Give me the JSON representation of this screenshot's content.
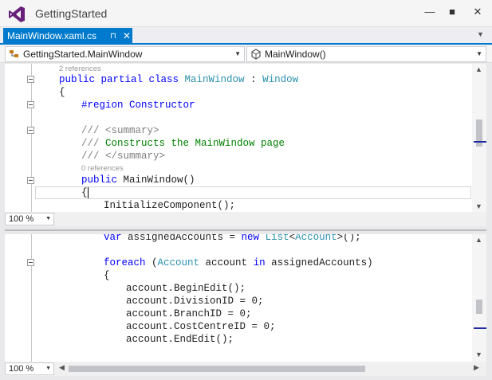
{
  "window": {
    "title": "GettingStarted",
    "minimize_icon": "minimize-icon",
    "maximize_icon": "maximize-icon",
    "close_icon": "close-icon"
  },
  "tab": {
    "label": "MainWindow.xaml.cs",
    "pin_icon": "pin-icon",
    "close_icon": "close-icon"
  },
  "navbar": {
    "class_combo": "GettingStarted.MainWindow",
    "member_combo": "MainWindow()"
  },
  "pane1": {
    "zoom": "100 %",
    "codelens_class": "2 references",
    "codelens_ctor": "0 references",
    "line1_kw": "public partial class ",
    "line1_type": "MainWindow",
    "line1_sep": " : ",
    "line1_base": "Window",
    "line2": "{",
    "line3_region": "#region Constructor",
    "line4_prefix": "/// ",
    "line4_tag": "<summary>",
    "line5_prefix": "/// ",
    "line5_text": "Constructs the MainWindow page",
    "line6_prefix": "/// ",
    "line6_tag": "</summary>",
    "line7_kw": "public ",
    "line7_rest": "MainWindow()",
    "line8": "{",
    "line9": "InitializeComponent();"
  },
  "pane2": {
    "zoom": "100 %",
    "l1_kw1": "var ",
    "l1_mid": "assignedAccounts = ",
    "l1_kw2": "new ",
    "l1_type1": "List",
    "l1_lt": "<",
    "l1_type2": "Account",
    "l1_end": ">();",
    "l2_kw": "foreach ",
    "l2_open": "(",
    "l2_type": "Account",
    "l2_mid": " account ",
    "l2_kw2": "in ",
    "l2_end": "assignedAccounts)",
    "l3": "{",
    "l4": "account.BeginEdit();",
    "l5": "account.DivisionID = 0;",
    "l6": "account.BranchID = 0;",
    "l7": "account.CostCentreID = 0;",
    "l8": "account.EndEdit();"
  },
  "colors": {
    "accent": "#007acc",
    "keyword": "#0000ff",
    "type": "#2b91af",
    "comment": "#008000"
  }
}
